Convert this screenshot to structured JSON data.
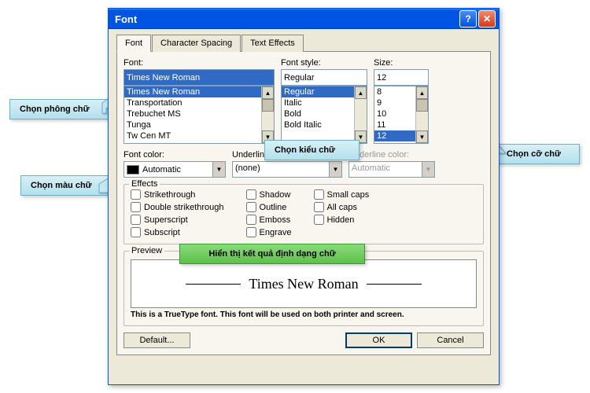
{
  "title": "Font",
  "tabs": [
    "Font",
    "Character Spacing",
    "Text Effects"
  ],
  "tabs_u": [
    "F",
    "R",
    "x"
  ],
  "font": {
    "label": "Font:",
    "value": "Times New Roman",
    "items": [
      "Times New Roman",
      "Transportation",
      "Trebuchet MS",
      "Tunga",
      "Tw Cen MT"
    ]
  },
  "style": {
    "label": "Font style:",
    "value": "Regular",
    "items": [
      "Regular",
      "Italic",
      "Bold",
      "Bold Italic"
    ]
  },
  "size": {
    "label": "Size:",
    "value": "12",
    "items": [
      "8",
      "9",
      "10",
      "11",
      "12"
    ]
  },
  "color": {
    "label": "Font color:",
    "value": "Automatic"
  },
  "uline": {
    "label": "Underline style:",
    "value": "(none)"
  },
  "ucolor": {
    "label": "Underline color:",
    "value": "Automatic"
  },
  "effects": {
    "title": "Effects",
    "col1": [
      "Strikethrough",
      "Double strikethrough",
      "Superscript",
      "Subscript"
    ],
    "col2": [
      "Shadow",
      "Outline",
      "Emboss",
      "Engrave"
    ],
    "col3": [
      "Small caps",
      "All caps",
      "Hidden"
    ]
  },
  "preview": {
    "title": "Preview",
    "text": "Times New Roman"
  },
  "footnote": "This is a TrueType font. This font will be used on both printer and screen.",
  "buttons": {
    "default": "Default...",
    "ok": "OK",
    "cancel": "Cancel"
  },
  "callouts": {
    "font": "Chọn phông chữ",
    "style": "Chọn kiểu chữ",
    "size": "Chọn cỡ chữ",
    "color": "Chọn màu chữ",
    "preview": "Hiển thị kết quả định dạng chữ"
  }
}
